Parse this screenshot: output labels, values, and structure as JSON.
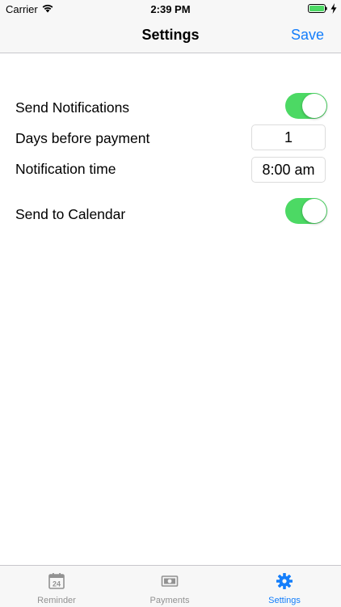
{
  "status_bar": {
    "carrier": "Carrier",
    "time": "2:39 PM",
    "wifi_icon": "wifi-icon",
    "battery_icon": "battery-icon",
    "charging_icon": "bolt-icon"
  },
  "nav": {
    "title": "Settings",
    "save_label": "Save"
  },
  "settings": {
    "send_notifications": {
      "label": "Send Notifications",
      "on": true
    },
    "days_before_payment": {
      "label": "Days before payment",
      "value": "1"
    },
    "notification_time": {
      "label": "Notification time",
      "value": "8:00 am"
    },
    "send_to_calendar": {
      "label": "Send to Calendar",
      "on": true
    }
  },
  "tabs": [
    {
      "label": "Reminder",
      "icon": "calendar-icon",
      "active": false
    },
    {
      "label": "Payments",
      "icon": "money-icon",
      "active": false
    },
    {
      "label": "Settings",
      "icon": "gear-icon",
      "active": true
    }
  ],
  "colors": {
    "accent": "#147efb",
    "toggle_on": "#4cd964",
    "inactive_tab": "#929292",
    "bar_background": "#f7f7f7"
  },
  "calendar_icon_day": "24"
}
